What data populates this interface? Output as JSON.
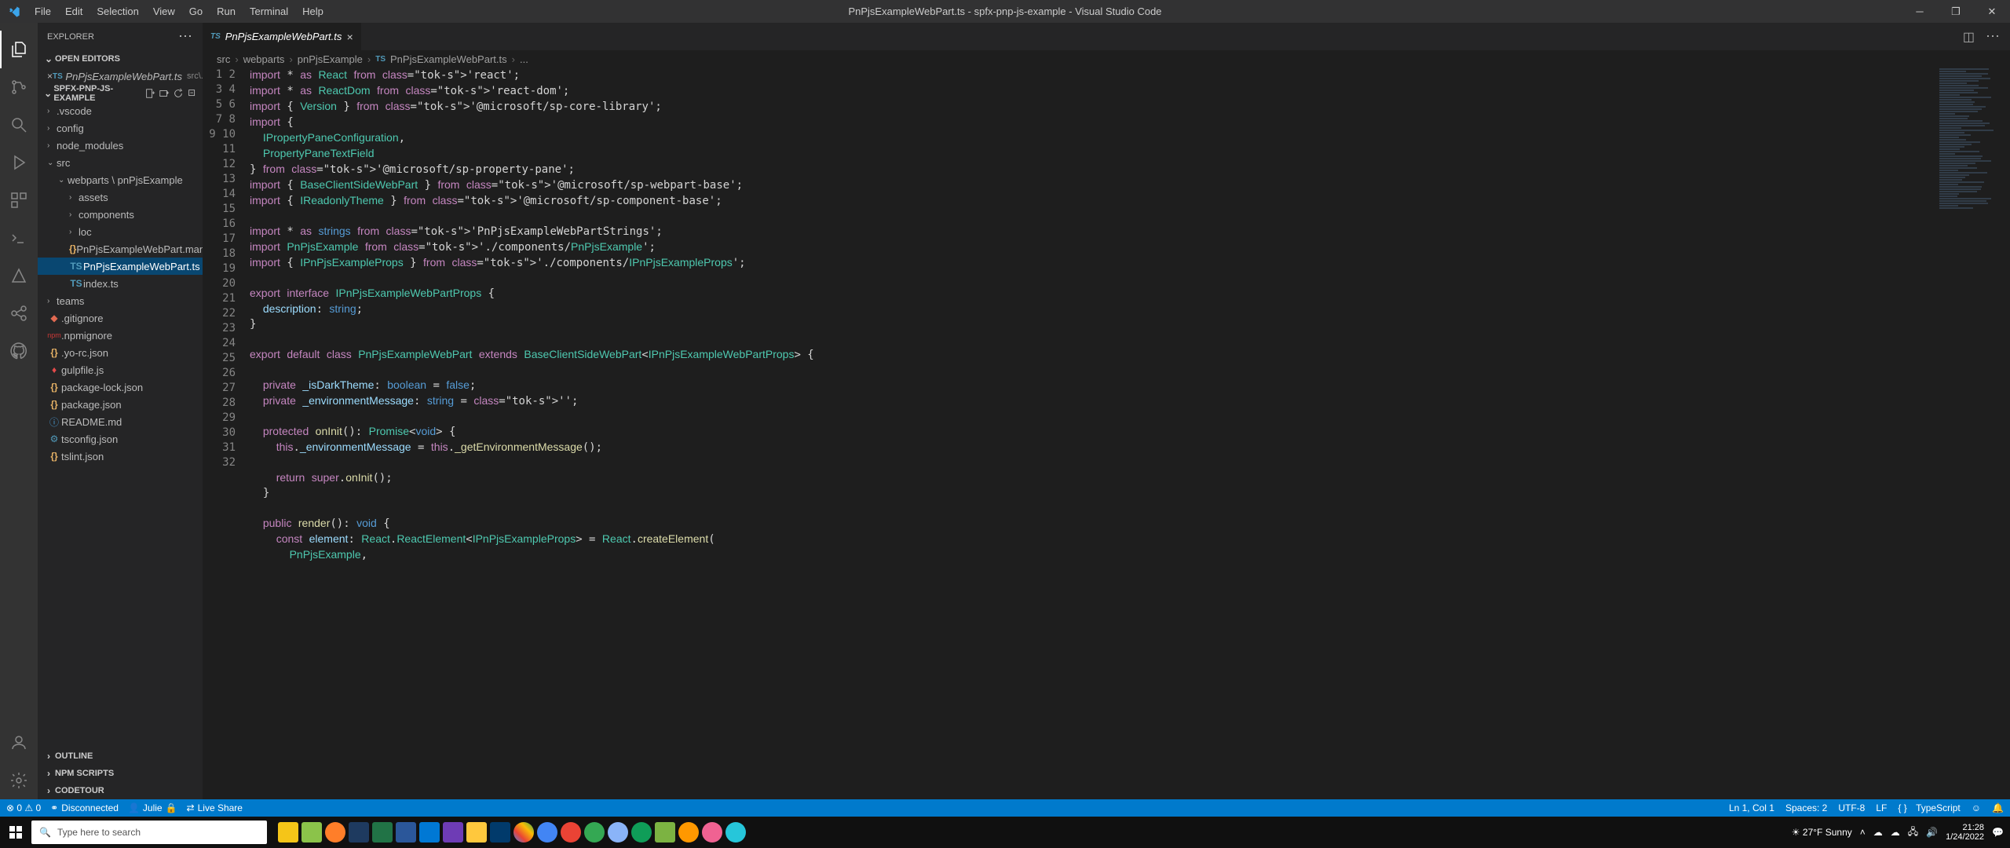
{
  "window": {
    "title": "PnPjsExampleWebPart.ts - spfx-pnp-js-example - Visual Studio Code"
  },
  "menu": {
    "file": "File",
    "edit": "Edit",
    "selection": "Selection",
    "view": "View",
    "go": "Go",
    "run": "Run",
    "terminal": "Terminal",
    "help": "Help"
  },
  "explorer": {
    "title": "EXPLORER",
    "openEditors": "OPEN EDITORS",
    "openTab": "PnPjsExampleWebPart.ts",
    "openTabMeta": "src\\...",
    "project": "SPFX-PNP-JS-EXAMPLE",
    "tree": {
      "vscode": ".vscode",
      "config": "config",
      "node_modules": "node_modules",
      "src": "src",
      "webparts": "webparts \\ pnPjsExample",
      "assets": "assets",
      "components": "components",
      "loc": "loc",
      "manifest": "PnPjsExampleWebPart.manifest....",
      "webpartts": "PnPjsExampleWebPart.ts",
      "indexts": "index.ts",
      "teams": "teams",
      "gitignore": ".gitignore",
      "npmignore": ".npmignore",
      "yorc": ".yo-rc.json",
      "gulp": "gulpfile.js",
      "pkglock": "package-lock.json",
      "pkg": "package.json",
      "readme": "README.md",
      "tsconfig": "tsconfig.json",
      "tslint": "tslint.json"
    },
    "outline": "OUTLINE",
    "npm": "NPM SCRIPTS",
    "codetour": "CODETOUR"
  },
  "tab": {
    "name": "PnPjsExampleWebPart.ts",
    "lang": "TS"
  },
  "breadcrumb": {
    "a": "src",
    "b": "webparts",
    "c": "pnPjsExample",
    "d": "PnPjsExampleWebPart.ts",
    "e": "...",
    "lang": "TS"
  },
  "lines": 32,
  "code": {
    "l1": "import * as React from 'react';",
    "l2": "import * as ReactDom from 'react-dom';",
    "l3": "import { Version } from '@microsoft/sp-core-library';",
    "l4": "import {",
    "l5": "  IPropertyPaneConfiguration,",
    "l6": "  PropertyPaneTextField",
    "l7": "} from '@microsoft/sp-property-pane';",
    "l8": "import { BaseClientSideWebPart } from '@microsoft/sp-webpart-base';",
    "l9": "import { IReadonlyTheme } from '@microsoft/sp-component-base';",
    "l10": "",
    "l11": "import * as strings from 'PnPjsExampleWebPartStrings';",
    "l12": "import PnPjsExample from './components/PnPjsExample';",
    "l13": "import { IPnPjsExampleProps } from './components/IPnPjsExampleProps';",
    "l14": "",
    "l15": "export interface IPnPjsExampleWebPartProps {",
    "l16": "  description: string;",
    "l17": "}",
    "l18": "",
    "l19": "export default class PnPjsExampleWebPart extends BaseClientSideWebPart<IPnPjsExampleWebPartProps> {",
    "l20": "",
    "l21": "  private _isDarkTheme: boolean = false;",
    "l22": "  private _environmentMessage: string = '';",
    "l23": "",
    "l24": "  protected onInit(): Promise<void> {",
    "l25": "    this._environmentMessage = this._getEnvironmentMessage();",
    "l26": "",
    "l27": "    return super.onInit();",
    "l28": "  }",
    "l29": "",
    "l30": "  public render(): void {",
    "l31": "    const element: React.ReactElement<IPnPjsExampleProps> = React.createElement(",
    "l32": "      PnPjsExample,"
  },
  "status": {
    "warn_err": "⊗ 0 ⚠ 0",
    "conn": "Disconnected",
    "julie": "Julie",
    "liveshare": "Live Share",
    "lncol": "Ln 1, Col 1",
    "spaces": "Spaces: 2",
    "enc": "UTF-8",
    "eol": "LF",
    "lang": "TypeScript",
    "langicon": "{ }"
  },
  "taskbar": {
    "search_placeholder": "Type here to search",
    "weather": "27°F  Sunny",
    "time": "21:28",
    "date": "1/24/2022"
  }
}
